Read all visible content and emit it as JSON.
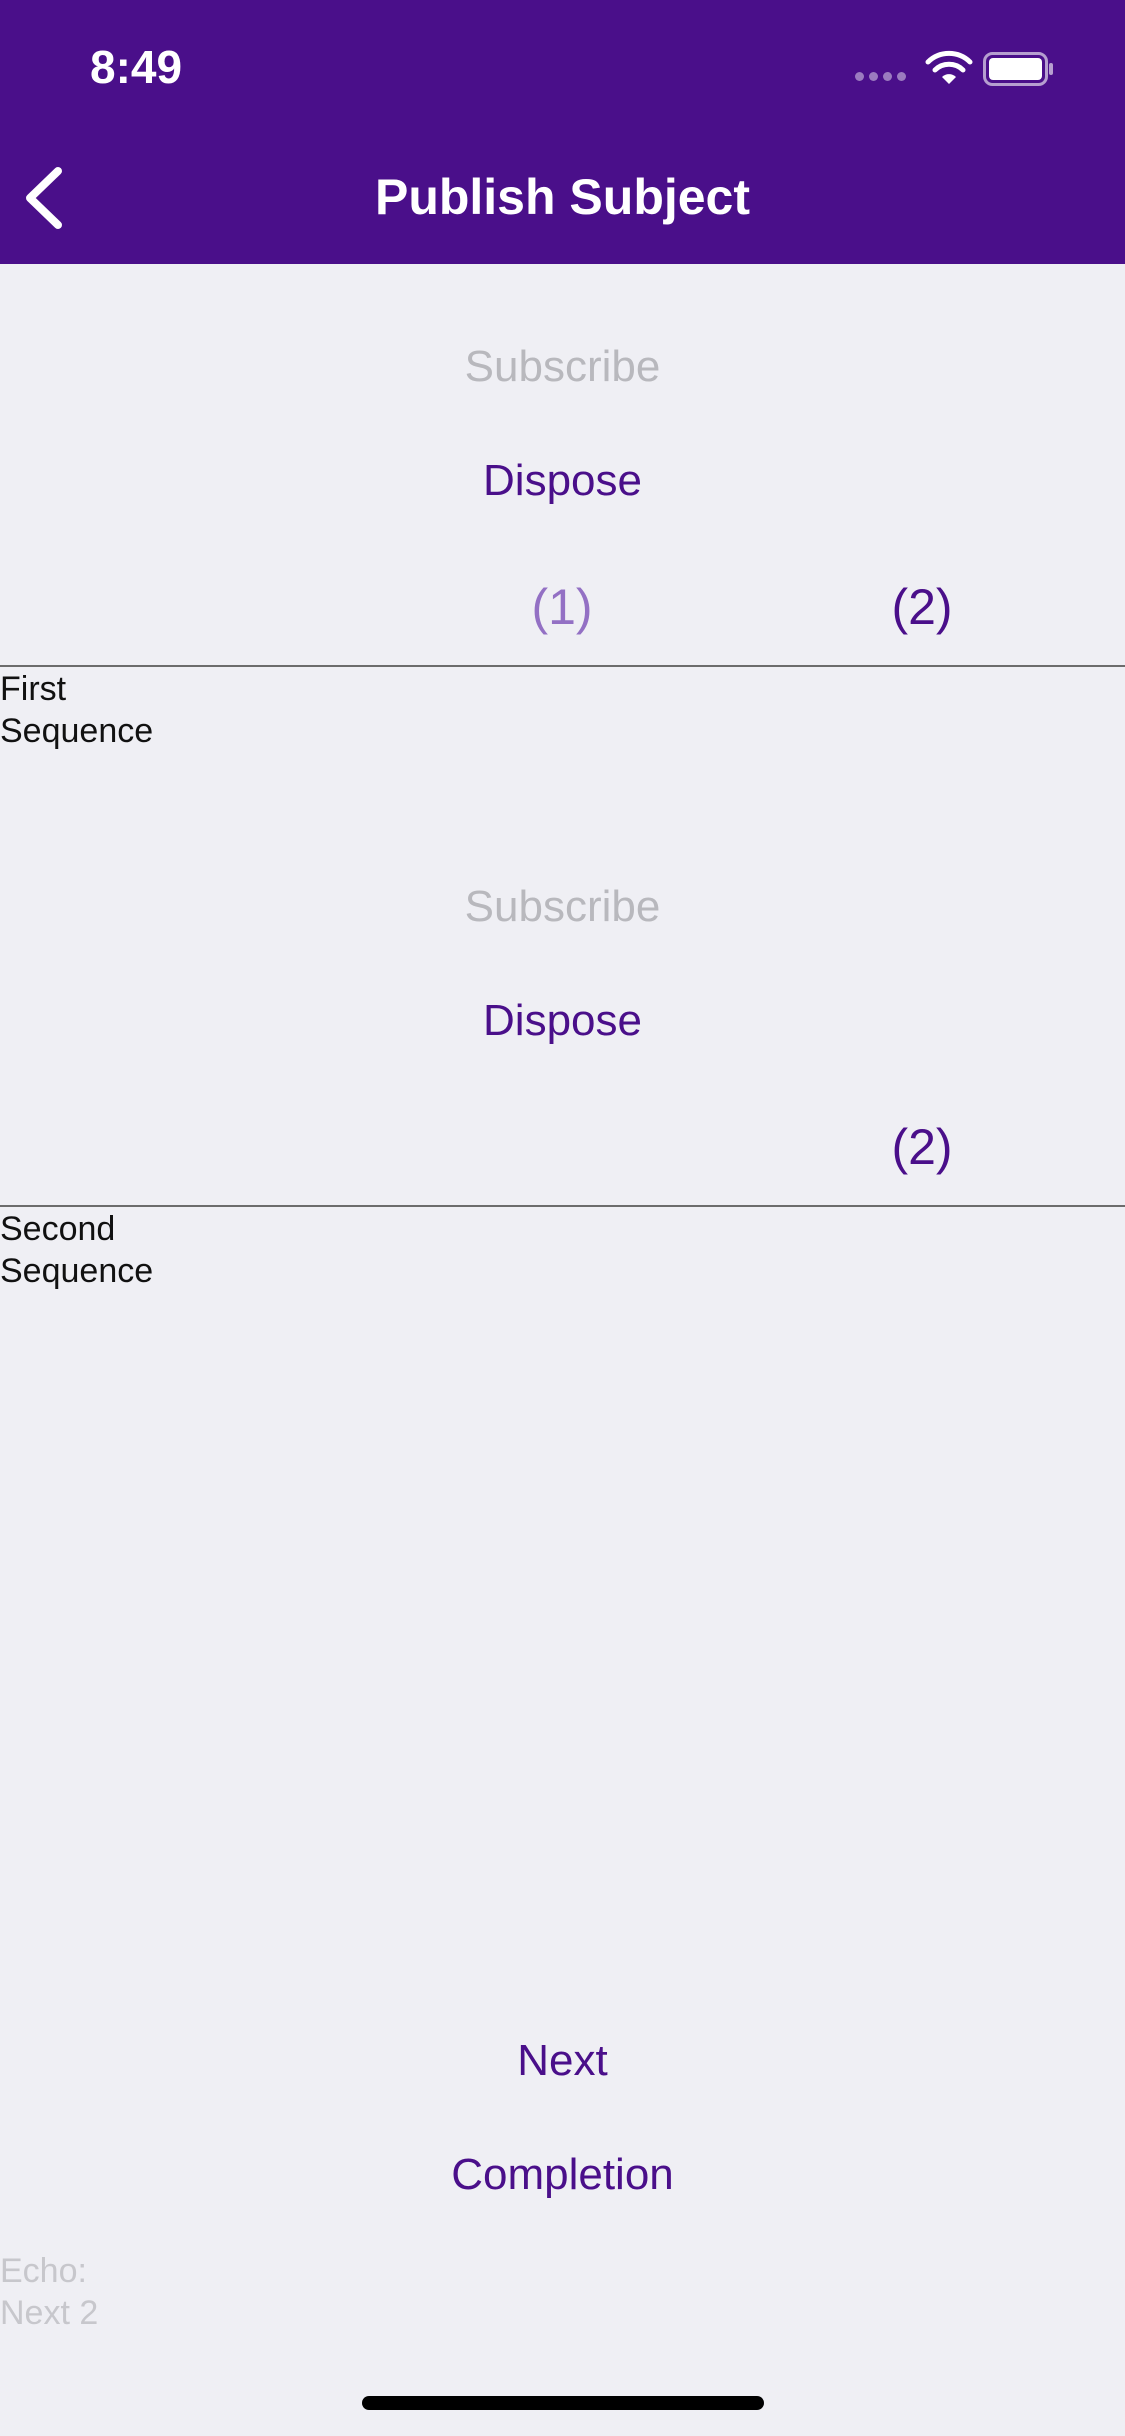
{
  "status_bar": {
    "time": "8:49"
  },
  "nav": {
    "title": "Publish Subject"
  },
  "first_sequence": {
    "subscribe_label": "Subscribe",
    "dispose_label": "Dispose",
    "counter_1": "(1)",
    "counter_2": "(2)",
    "label_line1": "First",
    "label_line2": "Sequence"
  },
  "second_sequence": {
    "subscribe_label": "Subscribe",
    "dispose_label": "Dispose",
    "counter_2": "(2)",
    "label_line1": "Second",
    "label_line2": "Sequence"
  },
  "controls": {
    "next_label": "Next",
    "completion_label": "Completion"
  },
  "echo": {
    "line1": "Echo:",
    "line2": "Next 2"
  },
  "colors": {
    "accent": "#4a0f8a",
    "disabled": "#b8b8bd",
    "background": "#efeff4"
  }
}
